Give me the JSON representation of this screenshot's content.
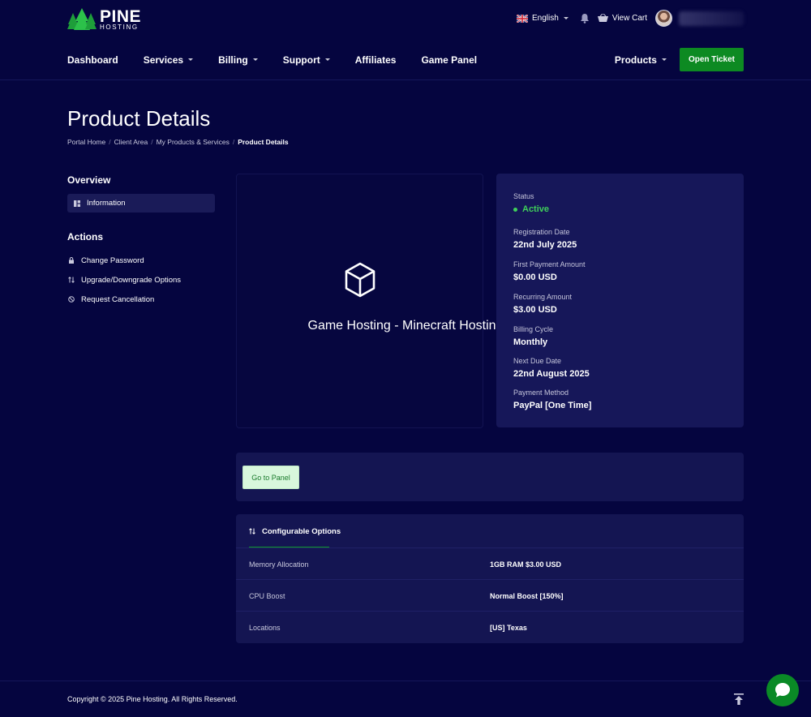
{
  "brand": {
    "name": "PINE",
    "sub": "HOSTING"
  },
  "topbar": {
    "language": "English",
    "view_cart": "View Cart"
  },
  "nav": {
    "items": [
      "Dashboard",
      "Services",
      "Billing",
      "Support",
      "Affiliates",
      "Game Panel"
    ],
    "products": "Products",
    "open_ticket": "Open Ticket"
  },
  "page": {
    "title": "Product Details",
    "breadcrumb": [
      "Portal Home",
      "Client Area",
      "My Products & Services",
      "Product Details"
    ]
  },
  "sidebar": {
    "overview_heading": "Overview",
    "information": "Information",
    "actions_heading": "Actions",
    "actions": [
      "Change Password",
      "Upgrade/Downgrade Options",
      "Request Cancellation"
    ]
  },
  "product": {
    "name": "Game Hosting - Minecraft Hosting"
  },
  "details": {
    "status_label": "Status",
    "status_value": "Active",
    "status_color": "#3fd05a",
    "fields": [
      {
        "label": "Registration Date",
        "value": "22nd July 2025"
      },
      {
        "label": "First Payment Amount",
        "value": "$0.00 USD"
      },
      {
        "label": "Recurring Amount",
        "value": "$3.00 USD"
      },
      {
        "label": "Billing Cycle",
        "value": "Monthly"
      },
      {
        "label": "Next Due Date",
        "value": "22nd August 2025"
      },
      {
        "label": "Payment Method",
        "value": "PayPal [One Time]"
      }
    ]
  },
  "panel": {
    "button": "Go to Panel"
  },
  "config": {
    "tab": "Configurable Options",
    "rows": [
      {
        "label": "Memory Allocation",
        "value": "1GB RAM $3.00 USD"
      },
      {
        "label": "CPU Boost",
        "value": "Normal Boost [150%]"
      },
      {
        "label": "Locations",
        "value": "[US] Texas"
      }
    ]
  },
  "footer": {
    "copyright": "Copyright © 2025 Pine Hosting. All Rights Reserved."
  },
  "colors": {
    "background": "#05053f",
    "accent": "#0d8a22",
    "card": "#141552"
  }
}
